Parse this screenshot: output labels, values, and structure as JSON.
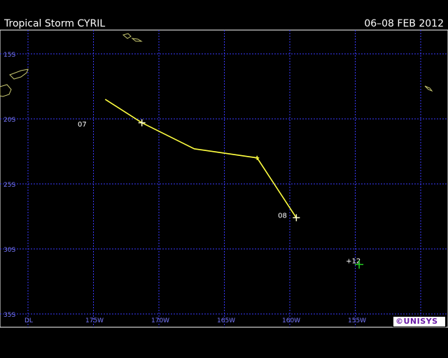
{
  "header": {
    "storm_title": "Tropical Storm CYRIL",
    "date_range": "06–08 FEB 2012"
  },
  "map": {
    "lat_labels": [
      "15S",
      "20S",
      "25S",
      "30S",
      "35S"
    ],
    "lon_labels": [
      "DL",
      "175W",
      "170W",
      "165W",
      "160W",
      "155W"
    ],
    "frame_color": "#ffffff",
    "grid_color": "#3a3aff",
    "coast_color": "#c8c870",
    "track_color": "#ffff40",
    "forecast_color": "#22cc22"
  },
  "track": {
    "day_labels": [
      {
        "label": "07",
        "lon": -176.2,
        "lat": -20.6
      },
      {
        "label": "08",
        "lon": -160.9,
        "lat": -27.6
      }
    ],
    "points": [
      {
        "lon": -174.1,
        "lat": -18.5
      },
      {
        "lon": -171.3,
        "lat": -20.3
      },
      {
        "lon": -167.3,
        "lat": -22.3
      },
      {
        "lon": -162.5,
        "lat": -23.0
      },
      {
        "lon": -159.5,
        "lat": -27.6
      }
    ],
    "forecast_label": "+12",
    "forecast_point": {
      "lon": -154.7,
      "lat": -31.2
    }
  },
  "logo": {
    "text": "©UNISYS"
  }
}
